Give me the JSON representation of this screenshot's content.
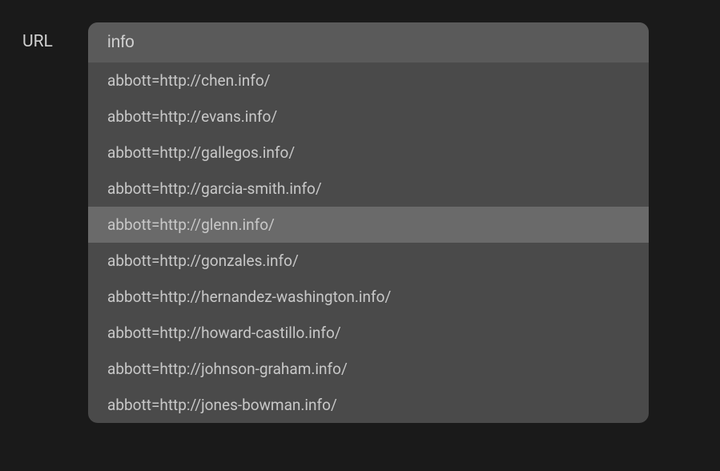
{
  "field": {
    "label": "URL"
  },
  "dropdown": {
    "input_value": "info",
    "highlighted_index": 4,
    "options": [
      "abbott=http://chen.info/",
      "abbott=http://evans.info/",
      "abbott=http://gallegos.info/",
      "abbott=http://garcia-smith.info/",
      "abbott=http://glenn.info/",
      "abbott=http://gonzales.info/",
      "abbott=http://hernandez-washington.info/",
      "abbott=http://howard-castillo.info/",
      "abbott=http://johnson-graham.info/",
      "abbott=http://jones-bowman.info/"
    ]
  }
}
